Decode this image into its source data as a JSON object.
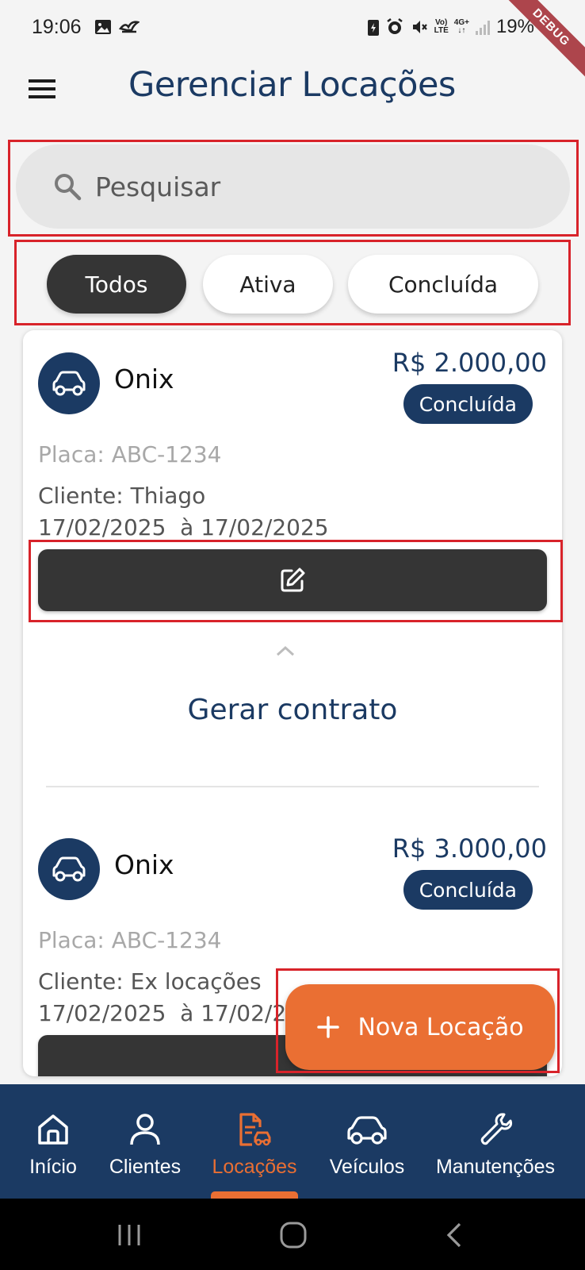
{
  "status_bar": {
    "time": "19:06",
    "battery": "19%",
    "network_top": "Vo)",
    "network_bottom": "LTE",
    "net_type": "4G+",
    "icons": [
      "gallery-icon",
      "bird-icon",
      "battery-saver-icon",
      "alarm-icon",
      "mute-icon",
      "signal-icon"
    ]
  },
  "debug_banner": "DEBUG",
  "app_bar": {
    "title": "Gerenciar Locações",
    "menu_icon": "menu-icon"
  },
  "search": {
    "placeholder": "Pesquisar",
    "value": ""
  },
  "filters": {
    "items": [
      {
        "label": "Todos",
        "selected": true
      },
      {
        "label": "Ativa",
        "selected": false
      },
      {
        "label": "Concluída",
        "selected": false
      }
    ]
  },
  "rentals": [
    {
      "vehicle": "Onix",
      "price": "R$ 2.000,00",
      "status": "Concluída",
      "plate": "Placa: ABC-1234",
      "client": "Cliente: Thiago",
      "dates": "17/02/2025  à 17/02/2025",
      "expanded": true,
      "contract_label": "Gerar contrato"
    },
    {
      "vehicle": "Onix",
      "price": "R$ 3.000,00",
      "status": "Concluída",
      "plate": "Placa: ABC-1234",
      "client": "Cliente: Ex locações",
      "dates": "17/02/2025  à 17/02/2025"
    }
  ],
  "fab": {
    "label": "Nova Locação"
  },
  "bottom_nav": {
    "items": [
      {
        "label": "Início",
        "icon": "home-icon"
      },
      {
        "label": "Clientes",
        "icon": "person-icon"
      },
      {
        "label": "Locações",
        "icon": "rental-document-icon",
        "active": true
      },
      {
        "label": "Veículos",
        "icon": "car-icon"
      },
      {
        "label": "Manutenções",
        "icon": "wrench-icon"
      }
    ]
  },
  "colors": {
    "primary": "#1b3a63",
    "accent": "#ea6f33",
    "dark_button": "#353535",
    "highlight": "#d8232a"
  }
}
